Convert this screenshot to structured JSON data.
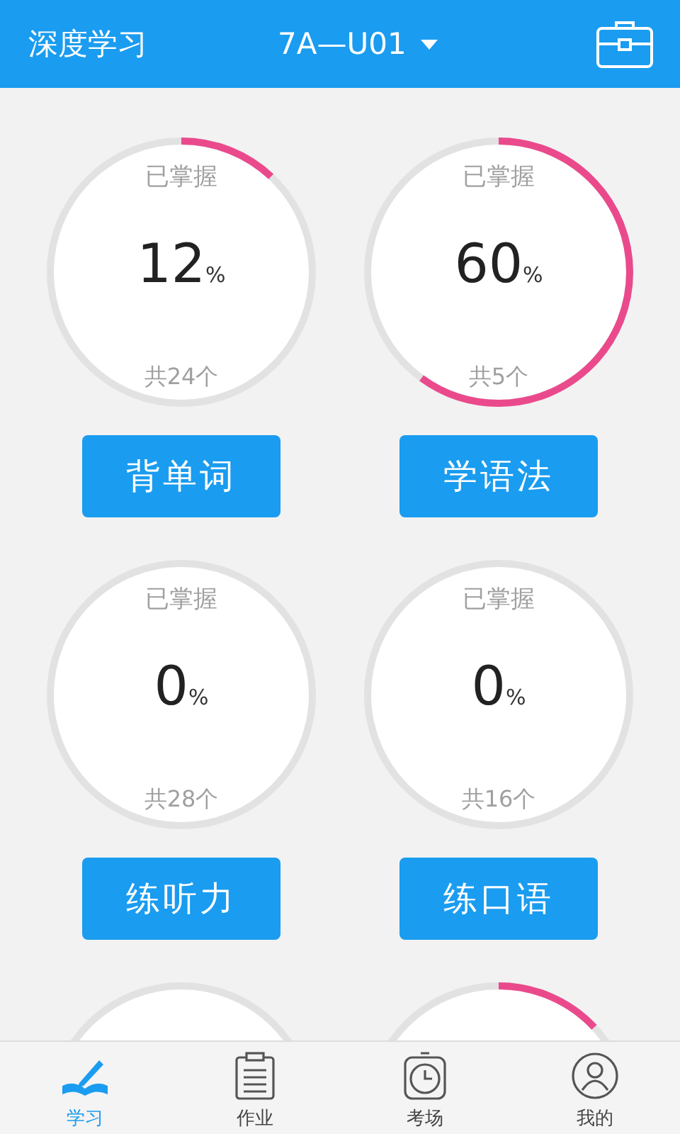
{
  "header": {
    "title": "深度学习",
    "unit": "7A—U01"
  },
  "cards": [
    {
      "label": "已掌握",
      "value": "12",
      "unit": "%",
      "total": "共24个",
      "level": 0.12,
      "button": "背单词"
    },
    {
      "label": "已掌握",
      "value": "60",
      "unit": "%",
      "total": "共5个",
      "level": 0.6,
      "button": "学语法"
    },
    {
      "label": "已掌握",
      "value": "0",
      "unit": "%",
      "total": "共28个",
      "level": 0,
      "button": "练听力"
    },
    {
      "label": "已掌握",
      "value": "0",
      "unit": "%",
      "total": "共16个",
      "level": 0,
      "button": "练口语"
    },
    {
      "level": 0
    },
    {
      "level": 0.13
    }
  ],
  "tabs": [
    {
      "label": "学习",
      "selected": true
    },
    {
      "label": "作业",
      "selected": false
    },
    {
      "label": "考场",
      "selected": false
    },
    {
      "label": "我的",
      "selected": false
    }
  ]
}
